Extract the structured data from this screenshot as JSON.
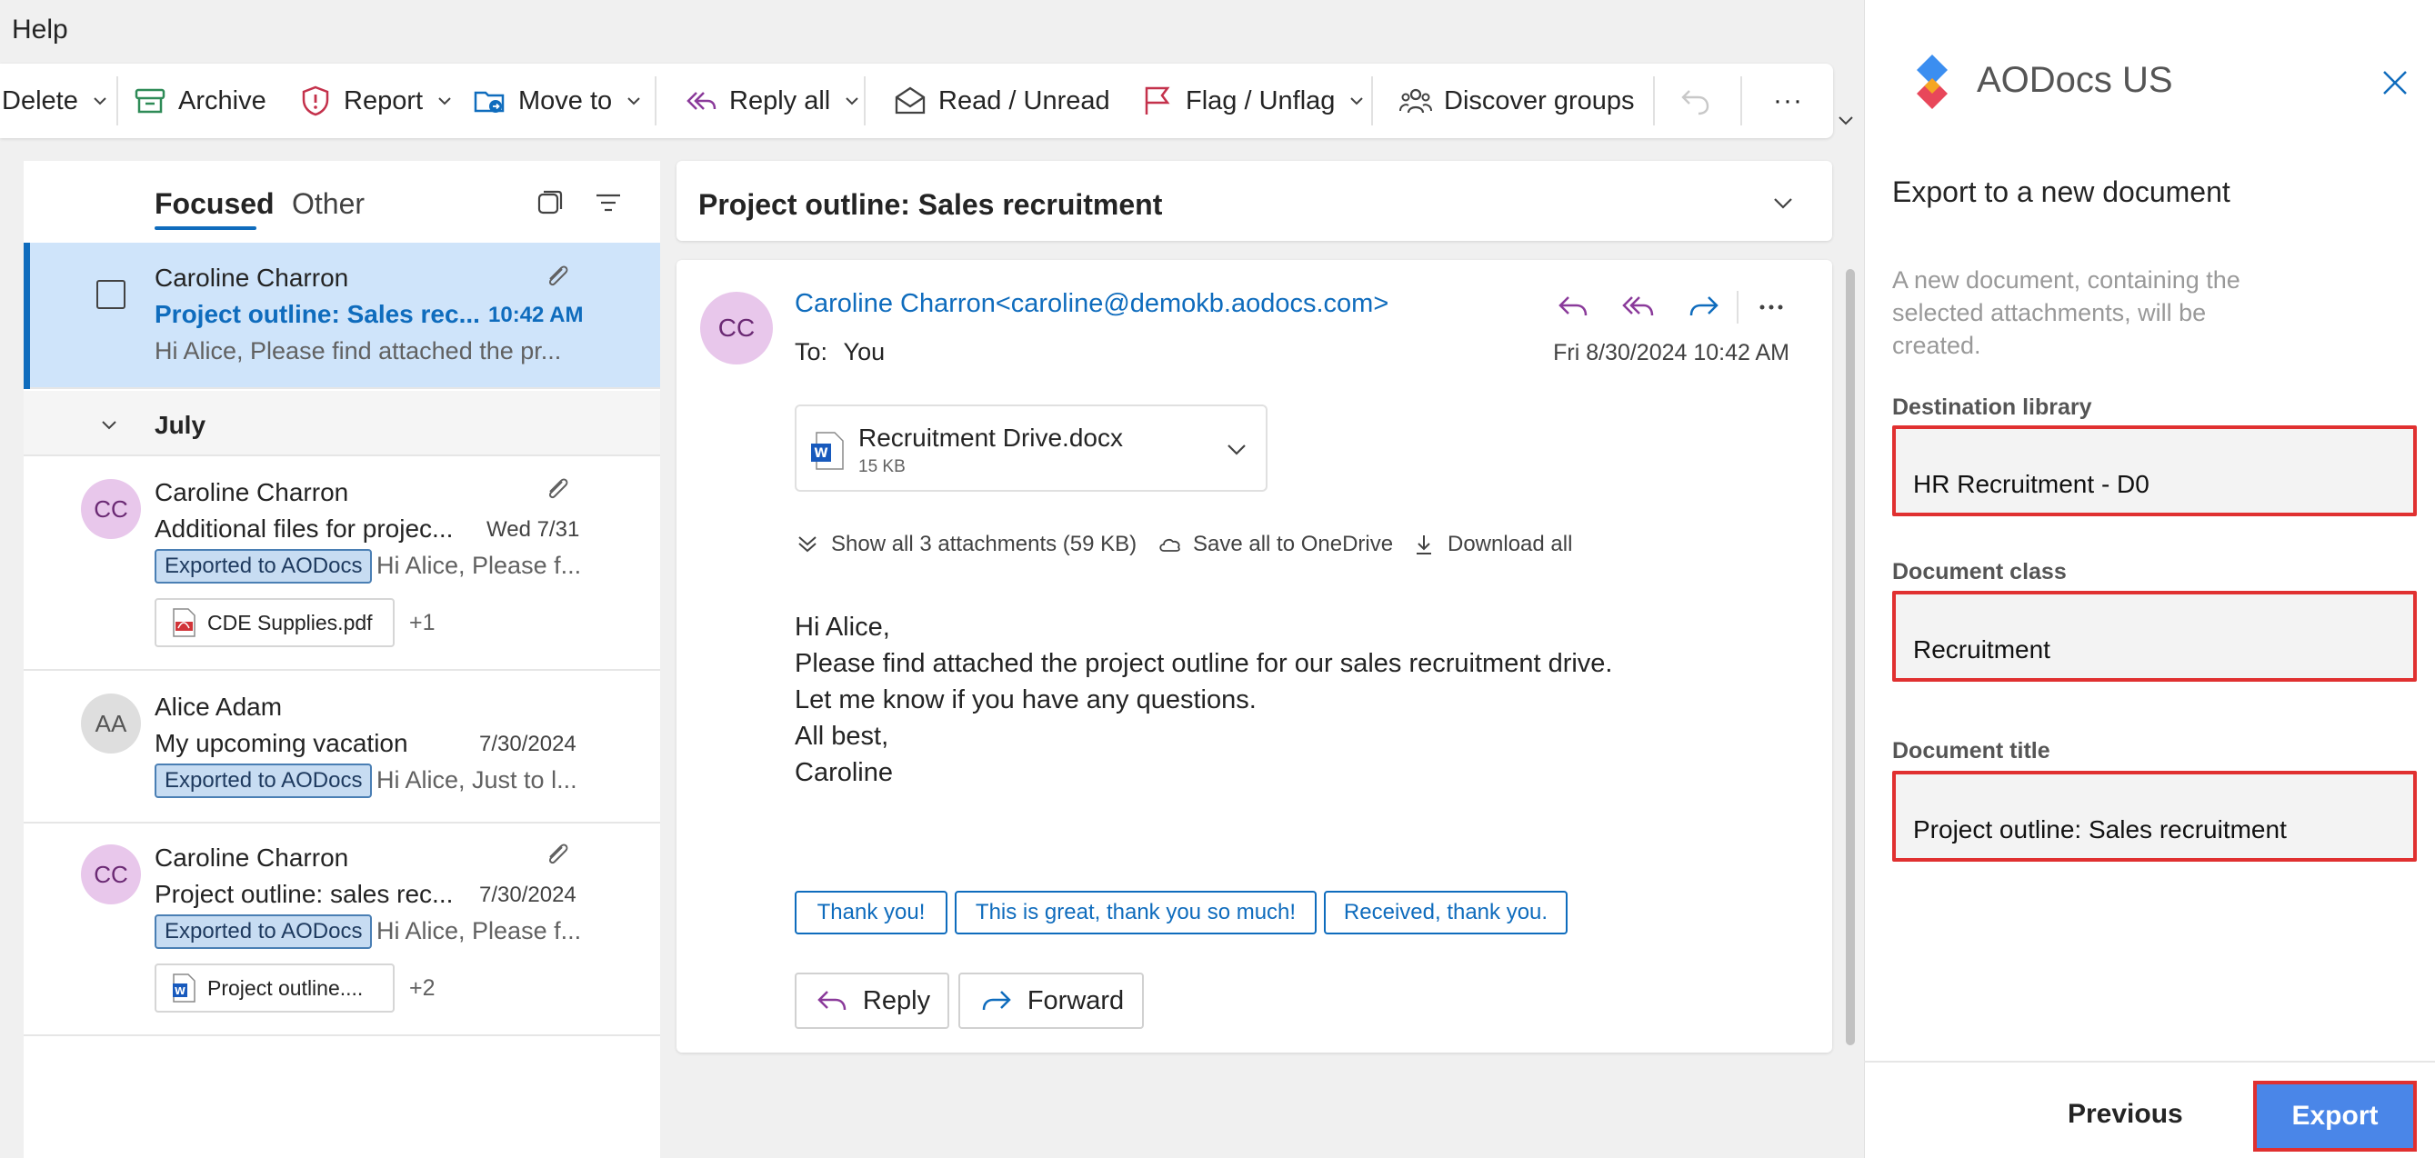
{
  "menu": {
    "help": "Help"
  },
  "ribbon": {
    "delete": "Delete",
    "archive": "Archive",
    "report": "Report",
    "move_to": "Move to",
    "reply_all": "Reply all",
    "read_unread": "Read / Unread",
    "flag_unflag": "Flag / Unflag",
    "discover_groups": "Discover groups",
    "more": "···"
  },
  "maillist": {
    "tabs": {
      "focused": "Focused",
      "other": "Other"
    },
    "selected": {
      "sender": "Caroline Charron",
      "subject": "Project outline: Sales rec...",
      "time": "10:42 AM",
      "preview": "Hi Alice, Please find attached the pr..."
    },
    "group_label": "July",
    "items": [
      {
        "initials": "CC",
        "sender": "Caroline Charron",
        "subject": "Additional files for projec...",
        "date": "Wed 7/31",
        "badge": "Exported to AODocs",
        "preview": "Hi Alice, Please f...",
        "attachment": "CDE Supplies.pdf",
        "more": "+1"
      },
      {
        "initials": "AA",
        "sender": "Alice Adam",
        "subject": "My upcoming vacation",
        "date": "7/30/2024",
        "badge": "Exported to AODocs",
        "preview": "Hi Alice, Just to l..."
      },
      {
        "initials": "CC",
        "sender": "Caroline Charron",
        "subject": "Project outline: sales rec...",
        "date": "7/30/2024",
        "badge": "Exported to AODocs",
        "preview": "Hi Alice, Please f...",
        "attachment": "Project outline....",
        "more": "+2"
      }
    ]
  },
  "reading": {
    "subject": "Project outline: Sales recruitment",
    "avatar": "CC",
    "from": "Caroline Charron<caroline@demokb.aodocs.com>",
    "to_label": "To:",
    "to_value": "You",
    "date": "Fri 8/30/2024 10:42 AM",
    "attachment": {
      "name": "Recruitment Drive.docx",
      "size": "15 KB"
    },
    "attachment_actions": {
      "show_all": "Show all 3 attachments (59 KB)",
      "save_onedrive": "Save all to OneDrive",
      "download_all": "Download all"
    },
    "body": [
      "Hi Alice,",
      "Please find attached the project outline for our sales recruitment drive.",
      "Let me know if you have any questions.",
      "All best,",
      "Caroline"
    ],
    "quick_replies": [
      "Thank you!",
      "This is great, thank you so much!",
      "Received, thank you."
    ],
    "reply": "Reply",
    "forward": "Forward"
  },
  "panel": {
    "title": "AODocs US",
    "heading": "Export to a new document",
    "description": "A new document, containing the selected attachments, will be created.",
    "destination_label": "Destination library",
    "destination_value": "HR Recruitment - D0",
    "class_label": "Document class",
    "class_value": "Recruitment",
    "title_label": "Document title",
    "title_value": "Project outline: Sales recruitment",
    "previous": "Previous",
    "export": "Export"
  },
  "colors": {
    "accent": "#0f6cbd",
    "selected_row": "#cfe4fa",
    "badge_bg": "#c7dcf2",
    "highlight_border": "#e03030",
    "export_button": "#4a86e8",
    "reply_icon": "#8a3a9a"
  }
}
